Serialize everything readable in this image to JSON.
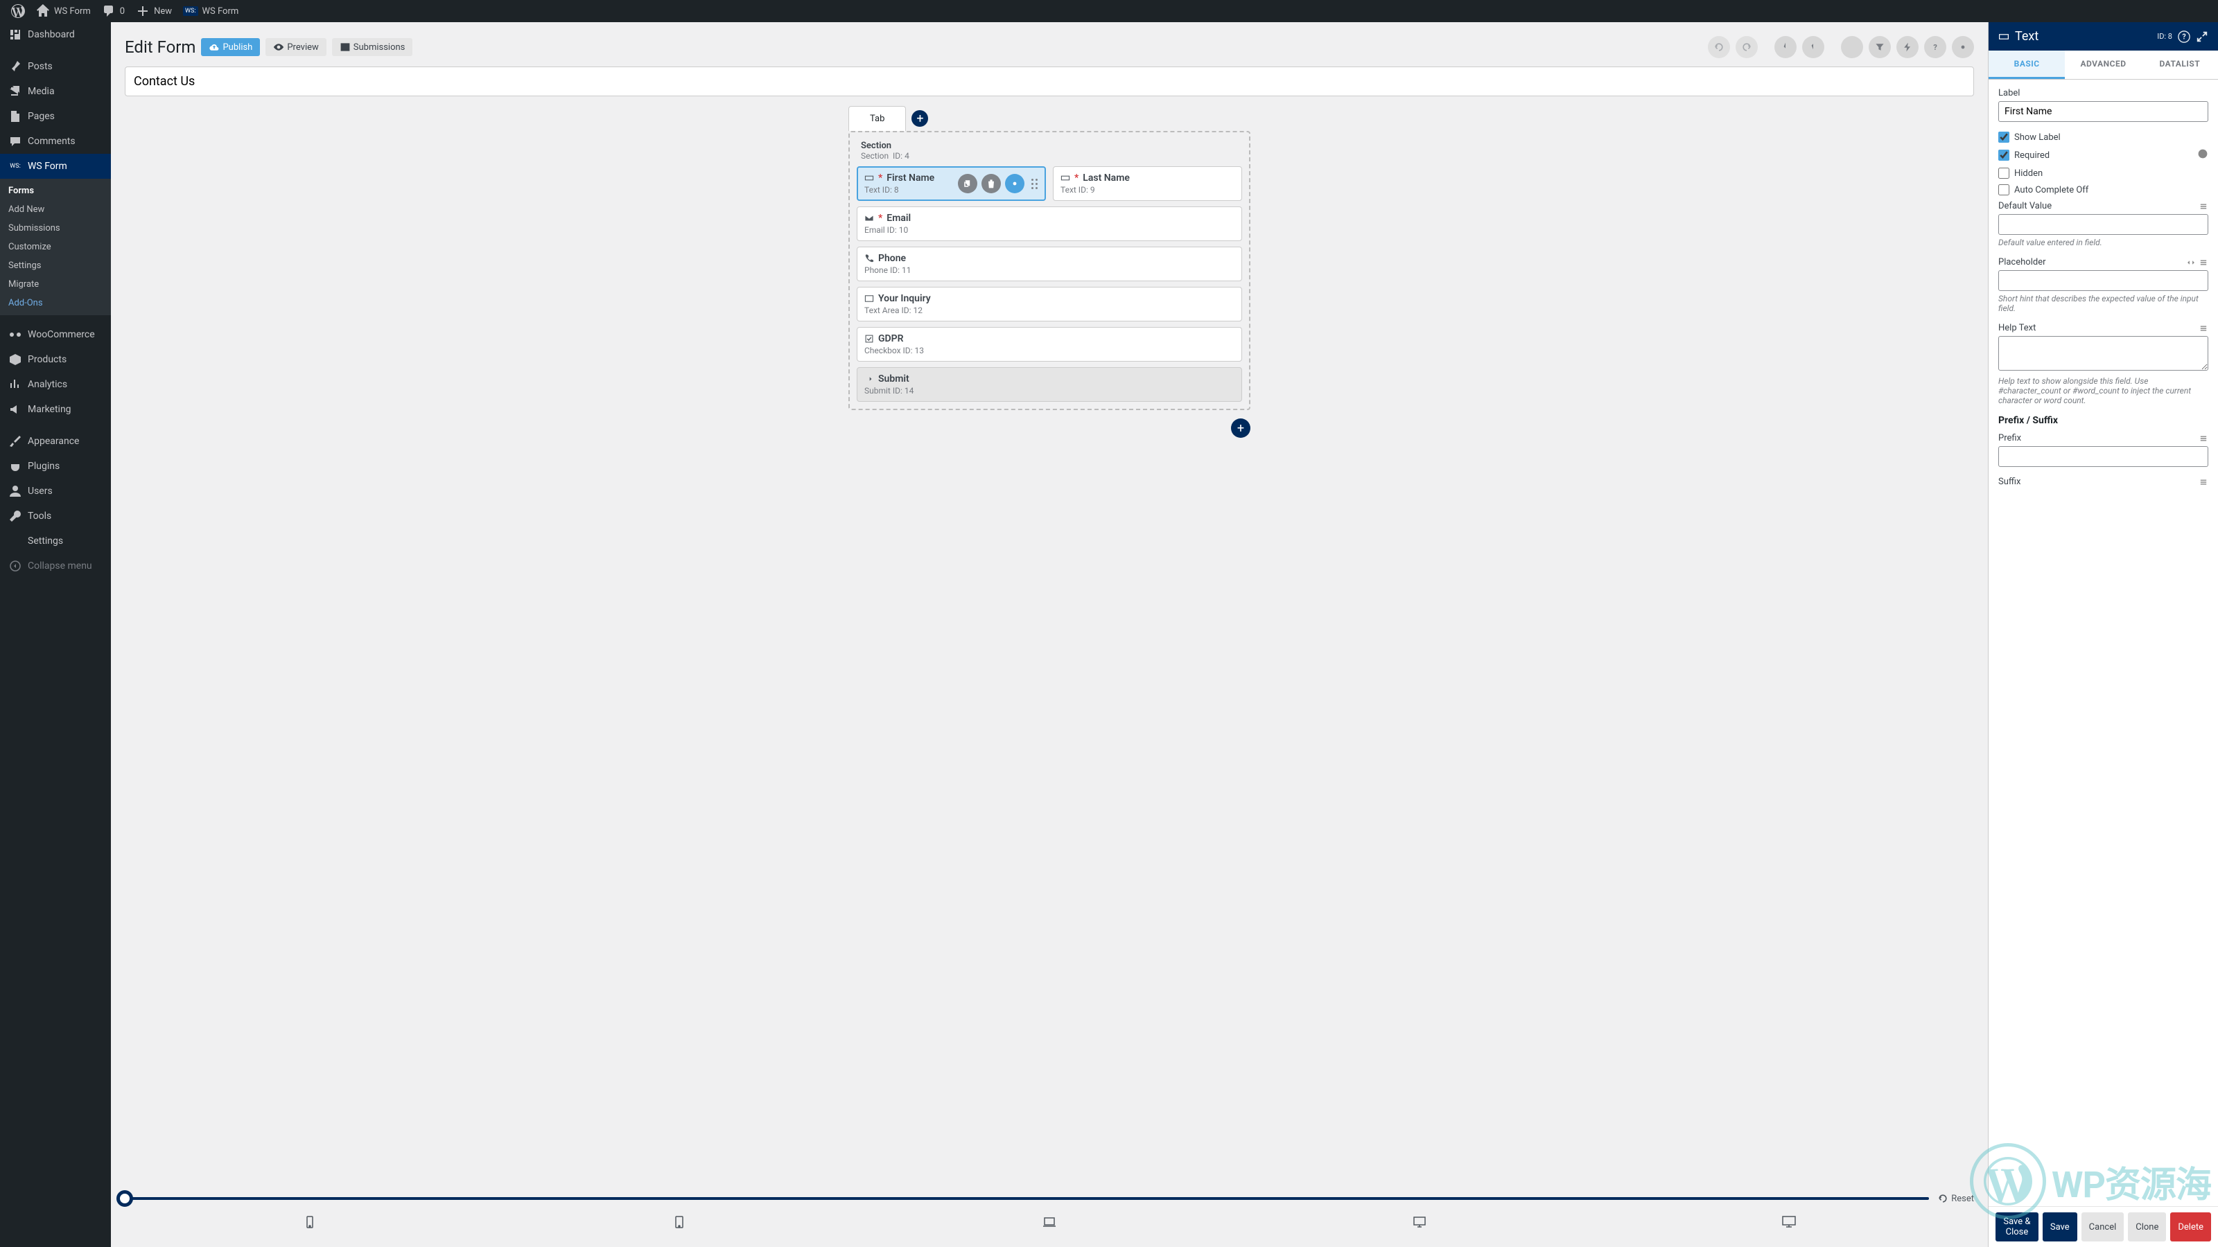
{
  "adminbar": {
    "site": "WS Form",
    "comments": "0",
    "new": "New",
    "screen": "WS Form"
  },
  "sidebar": {
    "items": [
      {
        "label": "Dashboard"
      },
      {
        "label": "Posts"
      },
      {
        "label": "Media"
      },
      {
        "label": "Pages"
      },
      {
        "label": "Comments"
      },
      {
        "label": "WS Form",
        "active": true
      },
      {
        "label": "WooCommerce"
      },
      {
        "label": "Products"
      },
      {
        "label": "Analytics"
      },
      {
        "label": "Marketing"
      },
      {
        "label": "Appearance"
      },
      {
        "label": "Plugins"
      },
      {
        "label": "Users"
      },
      {
        "label": "Tools"
      },
      {
        "label": "Settings"
      },
      {
        "label": "Collapse menu"
      }
    ],
    "submenu": [
      {
        "label": "Forms",
        "current": true
      },
      {
        "label": "Add New"
      },
      {
        "label": "Submissions"
      },
      {
        "label": "Customize"
      },
      {
        "label": "Settings"
      },
      {
        "label": "Migrate"
      },
      {
        "label": "Add-Ons",
        "highlight": true
      }
    ]
  },
  "builder": {
    "title": "Edit Form",
    "publish": "Publish",
    "preview": "Preview",
    "submissions": "Submissions",
    "form_name": "Contact Us",
    "tab_label": "Tab",
    "section": {
      "title": "Section",
      "meta_type": "Section",
      "meta_id": "ID: 4"
    },
    "fields": {
      "first_name": {
        "label": "First Name",
        "meta": "Text  ID: 8"
      },
      "last_name": {
        "label": "Last Name",
        "meta": "Text  ID: 9"
      },
      "email": {
        "label": "Email",
        "meta": "Email  ID: 10"
      },
      "phone": {
        "label": "Phone",
        "meta": "Phone  ID: 11"
      },
      "inquiry": {
        "label": "Your Inquiry",
        "meta": "Text Area  ID: 12"
      },
      "gdpr": {
        "label": "GDPR",
        "meta": "Checkbox  ID: 13"
      },
      "submit": {
        "label": "Submit",
        "meta": "Submit  ID: 14"
      }
    },
    "reset": "Reset"
  },
  "panel": {
    "title": "Text",
    "id_badge": "ID: 8",
    "tabs": {
      "basic": "BASIC",
      "advanced": "ADVANCED",
      "datalist": "DATALIST"
    },
    "label_label": "Label",
    "label_value": "First Name",
    "show_label": "Show Label",
    "required": "Required",
    "hidden": "Hidden",
    "autocomplete_off": "Auto Complete Off",
    "default_value_label": "Default Value",
    "default_value_hint": "Default value entered in field.",
    "placeholder_label": "Placeholder",
    "placeholder_hint": "Short hint that describes the expected value of the input field.",
    "help_text_label": "Help Text",
    "help_text_hint": "Help text to show alongside this field. Use #character_count or #word_count to inject the current character or word count.",
    "prefix_suffix_title": "Prefix / Suffix",
    "prefix_label": "Prefix",
    "suffix_label": "Suffix",
    "footer": {
      "save_close": "Save & Close",
      "save": "Save",
      "cancel": "Cancel",
      "clone": "Clone",
      "delete": "Delete"
    }
  },
  "watermark": "WP资源海"
}
